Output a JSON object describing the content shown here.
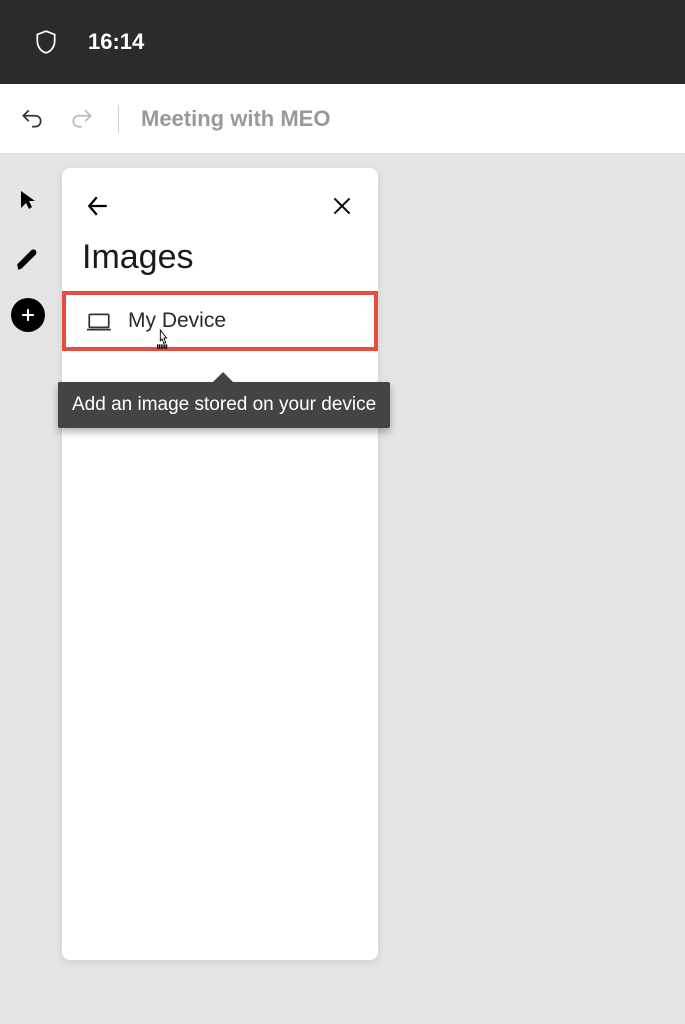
{
  "status": {
    "time": "16:14"
  },
  "toolbar": {
    "title": "Meeting with MEO"
  },
  "panel": {
    "title": "Images",
    "items": [
      {
        "label": "My Device"
      }
    ],
    "tooltip": "Add an image stored on your device"
  }
}
